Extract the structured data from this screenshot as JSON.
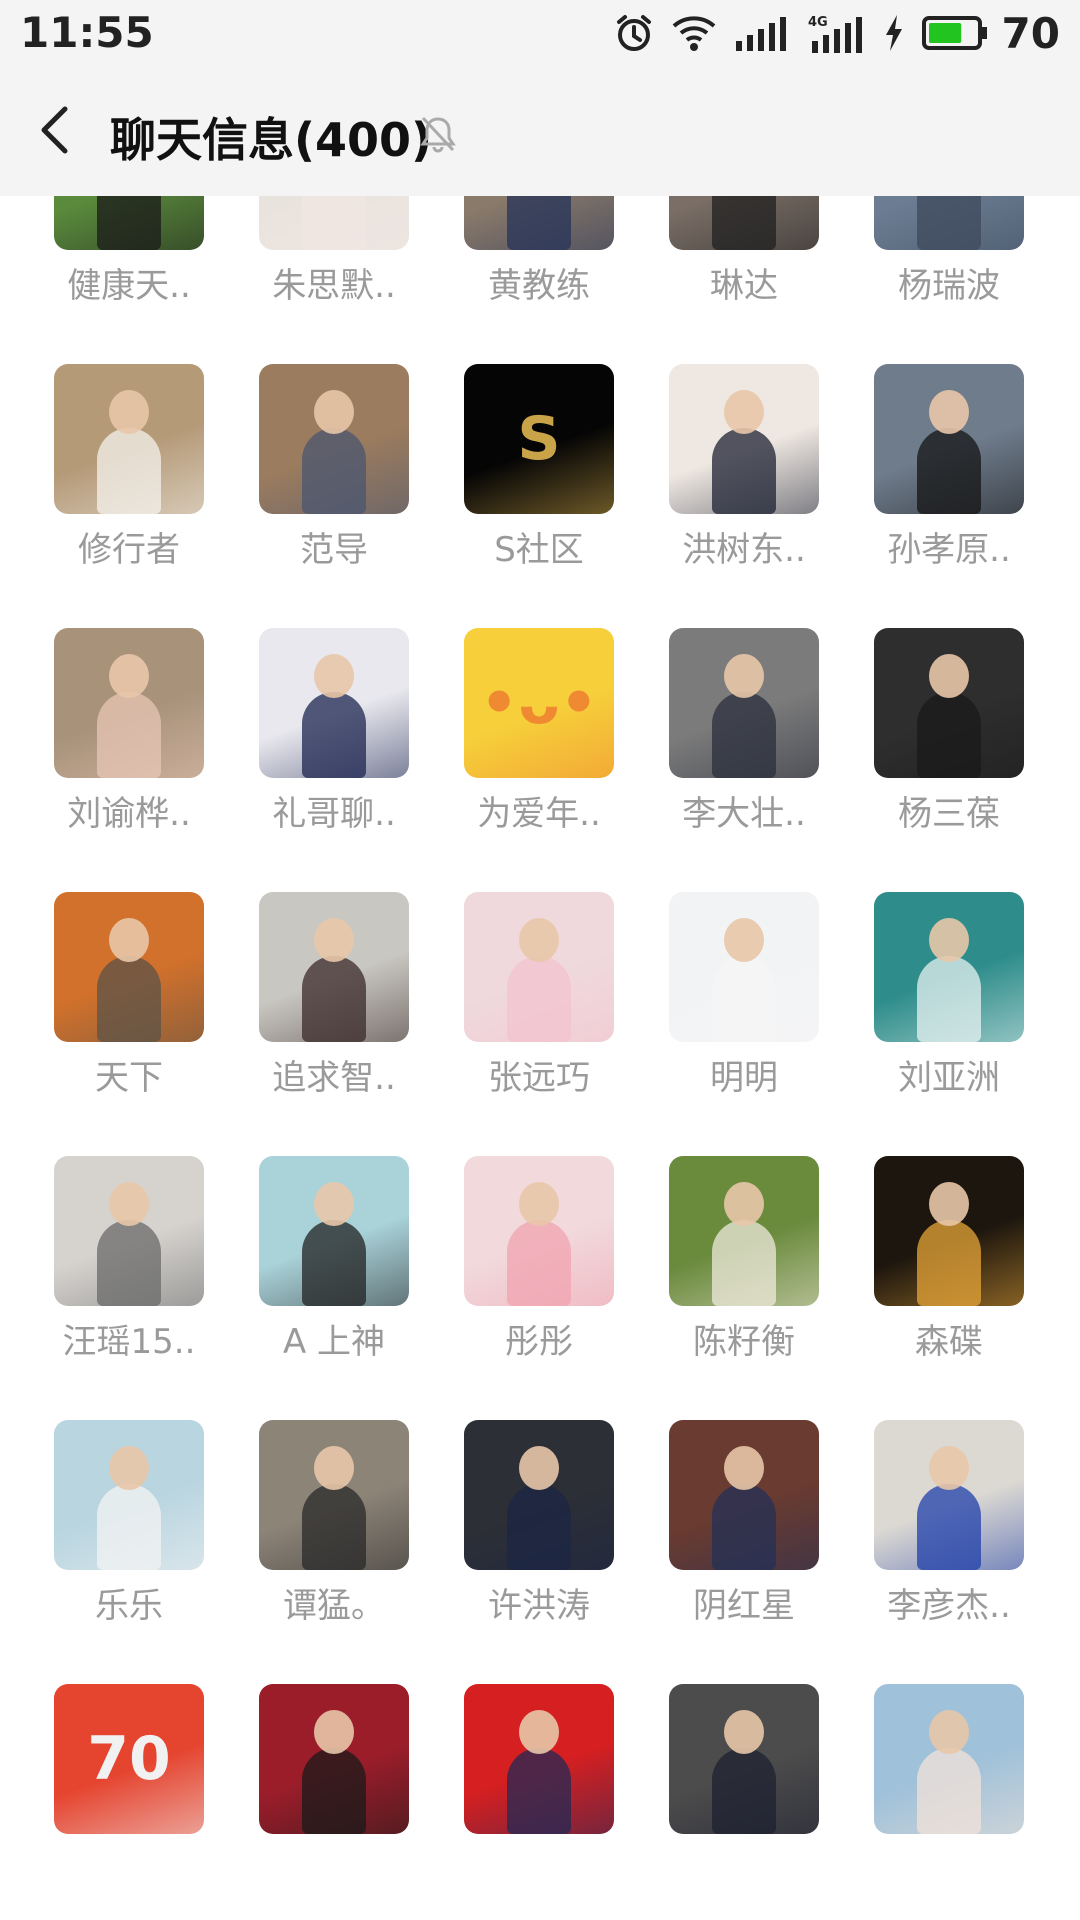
{
  "status_bar": {
    "time": "11:55",
    "battery_percent": "70",
    "network": "4G",
    "icons": [
      "alarm-icon",
      "wifi-icon",
      "signal-icon",
      "4g-signal-icon",
      "charging-icon",
      "battery-icon"
    ],
    "battery_color": "#22c41f"
  },
  "header": {
    "title": "聊天信息(400)",
    "back_icon": "chevron-left-icon",
    "mute_icon": "bell-muted-icon"
  },
  "members": [
    {
      "name": "健康天..",
      "bg": "#5a8a3c",
      "accent": "#1a1a1a"
    },
    {
      "name": "朱思默..",
      "bg": "#e9e3de",
      "accent": "#f2e7e2"
    },
    {
      "name": "黄教练",
      "bg": "#8a7a6a",
      "accent": "#253358"
    },
    {
      "name": "琳达",
      "bg": "#7a6e66",
      "accent": "#202020"
    },
    {
      "name": "杨瑞波",
      "bg": "#6c7d93",
      "accent": "#3d4a5c"
    },
    {
      "name": "修行者",
      "bg": "#b59a78",
      "accent": "#f4f2ec"
    },
    {
      "name": "范导",
      "bg": "#9c7c5e",
      "accent": "#4a5670"
    },
    {
      "name": "S社区",
      "bg": "#050505",
      "accent": "#c9a348",
      "glyph": "S"
    },
    {
      "name": "洪树东..",
      "bg": "#efe8e2",
      "accent": "#1d2233"
    },
    {
      "name": "孙孝原..",
      "bg": "#6f7c8c",
      "accent": "#141414"
    },
    {
      "name": "刘谕桦..",
      "bg": "#a8927a",
      "accent": "#e7c6b6"
    },
    {
      "name": "礼哥聊..",
      "bg": "#e8e8ee",
      "accent": "#1d2650"
    },
    {
      "name": "为爱年..",
      "bg": "#f6cf3a",
      "accent": "#f08a32",
      "glyph": "•ᴗ•"
    },
    {
      "name": "李大壮..",
      "bg": "#7b7b7b",
      "accent": "#2b2f3c"
    },
    {
      "name": "杨三葆",
      "bg": "#2e2e2e",
      "accent": "#1a1a1a"
    },
    {
      "name": "天下",
      "bg": "#d2712b",
      "accent": "#5b5348"
    },
    {
      "name": "追求智..",
      "bg": "#c9c7c1",
      "accent": "#3a2a28"
    },
    {
      "name": "张远巧",
      "bg": "#efd9dc",
      "accent": "#f3c3cf"
    },
    {
      "name": "明明",
      "bg": "#f2f3f5",
      "accent": "#f6f6f6"
    },
    {
      "name": "刘亚洲",
      "bg": "#2e8d8b",
      "accent": "#e7f2f1"
    },
    {
      "name": "汪瑶15..",
      "bg": "#d6d3cf",
      "accent": "#6a6a6a"
    },
    {
      "name": "A  上神",
      "bg": "#a9d2d9",
      "accent": "#222222"
    },
    {
      "name": "彤彤",
      "bg": "#f1d9dc",
      "accent": "#f0a3b0"
    },
    {
      "name": "陈籽衡",
      "bg": "#6a8a3c",
      "accent": "#efe9dc"
    },
    {
      "name": "森碟",
      "bg": "#1d160e",
      "accent": "#e7a538"
    },
    {
      "name": "乐乐",
      "bg": "#b9d5e0",
      "accent": "#f3f3f3"
    },
    {
      "name": "谭猛。",
      "bg": "#8d8478",
      "accent": "#2a2a2a"
    },
    {
      "name": "许洪涛",
      "bg": "#2c2f36",
      "accent": "#1c2544"
    },
    {
      "name": "阴红星",
      "bg": "#6a3b30",
      "accent": "#233055"
    },
    {
      "name": "李彦杰..",
      "bg": "#dcd9d3",
      "accent": "#1f3fa9"
    },
    {
      "name": "",
      "bg": "#e5442f",
      "accent": "#f1f1f1",
      "glyph": "70"
    },
    {
      "name": "",
      "bg": "#9b1d2a",
      "accent": "#1a1a1a"
    },
    {
      "name": "",
      "bg": "#d51f21",
      "accent": "#232a55"
    },
    {
      "name": "",
      "bg": "#4c4c4c",
      "accent": "#1e2030"
    },
    {
      "name": "",
      "bg": "#9fc1d9",
      "accent": "#f2e2d8"
    }
  ]
}
